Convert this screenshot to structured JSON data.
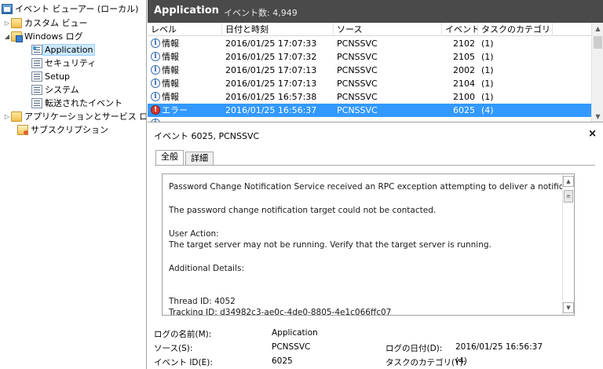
{
  "tree": {
    "items": [
      {
        "label": "イベント ビューアー (ローカル)",
        "icon": "event-viewer-icon"
      },
      {
        "label": "カスタム ビュー",
        "icon": "folder-icon"
      },
      {
        "label": "Windows ログ",
        "icon": "folder-icon"
      },
      {
        "label": "Application",
        "icon": "log-icon"
      },
      {
        "label": "セキュリティ",
        "icon": "log-icon"
      },
      {
        "label": "Setup",
        "icon": "log-icon"
      },
      {
        "label": "システム",
        "icon": "log-icon"
      },
      {
        "label": "転送されたイベント",
        "icon": "log-icon"
      },
      {
        "label": "アプリケーションとサービス ログ",
        "icon": "folder-icon"
      },
      {
        "label": "サブスクリプション",
        "icon": "subscription-icon"
      }
    ],
    "expanders": {
      "collapsed": "▷",
      "expanded": "◢"
    }
  },
  "header": {
    "title": "Application",
    "count": "イベント数: 4,949"
  },
  "grid": {
    "columns": [
      "レベル",
      "日付と時刻",
      "ソース",
      "イベント...",
      "タスクのカテゴリ"
    ],
    "rows": [
      {
        "level": "情報",
        "datetime": "2016/01/25 17:07:33",
        "source": "PCNSSVC",
        "id": "2102",
        "category": "(1)",
        "type": "info"
      },
      {
        "level": "情報",
        "datetime": "2016/01/25 17:07:32",
        "source": "PCNSSVC",
        "id": "2105",
        "category": "(1)",
        "type": "info"
      },
      {
        "level": "情報",
        "datetime": "2016/01/25 17:07:13",
        "source": "PCNSSVC",
        "id": "2002",
        "category": "(1)",
        "type": "info"
      },
      {
        "level": "情報",
        "datetime": "2016/01/25 17:07:13",
        "source": "PCNSSVC",
        "id": "2104",
        "category": "(1)",
        "type": "info"
      },
      {
        "level": "情報",
        "datetime": "2016/01/25 16:57:38",
        "source": "PCNSSVC",
        "id": "2100",
        "category": "(1)",
        "type": "info"
      },
      {
        "level": "エラー",
        "datetime": "2016/01/25 16:56:37",
        "source": "PCNSSVC",
        "id": "6025",
        "category": "(4)",
        "type": "error"
      }
    ],
    "selected_color": "#3399ff"
  },
  "detail": {
    "title": "イベント 6025, PCNSSVC",
    "close": "×",
    "tabs": [
      "全般",
      "詳細"
    ],
    "message_lines": [
      "Password Change Notification Service received an RPC exception attempting to deliver a notification.",
      "The password change notification target could not be contacted.",
      "User Action:",
      "The target server may not be running. Verify that the target server is running.",
      "Additional Details:",
      "Thread ID: 4052",
      "Tracking ID: d34982c3-ae0c-4de0-8805-4e1c066ffc07"
    ],
    "props": {
      "log_name_label": "ログの名前(M):",
      "log_name_value": "Application",
      "source_label": "ソース(S):",
      "source_value": "PCNSSVC",
      "logged_label": "ログの日付(D):",
      "logged_value": "2016/01/25 16:56:37",
      "event_id_label": "イベント ID(E):",
      "event_id_value": "6025",
      "task_label": "タスクのカテゴリ(Y):",
      "task_value": "(4)"
    }
  },
  "colors": {
    "header_bg": "#4a4a4a",
    "error_icon": "#d43a2a",
    "info_icon": "#3a6fb0"
  }
}
